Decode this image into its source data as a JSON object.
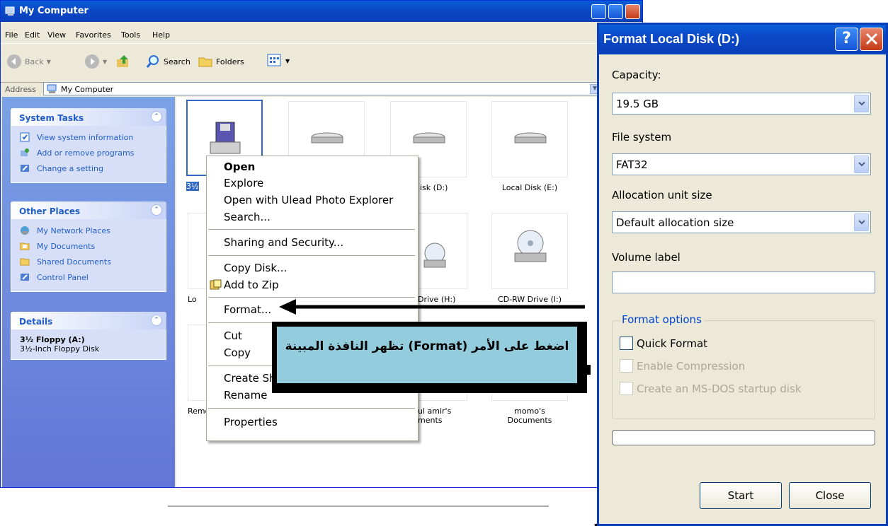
{
  "explorer": {
    "title": "My Computer",
    "menu": [
      "File",
      "Edit",
      "View",
      "Favorites",
      "Tools",
      "Help"
    ],
    "toolbar": {
      "back": "Back",
      "search": "Search",
      "folders": "Folders"
    },
    "address_label": "Address",
    "address_value": "My Computer",
    "system_tasks": {
      "title": "System Tasks",
      "items": [
        "View system information",
        "Add or remove programs",
        "Change a setting"
      ]
    },
    "other_places": {
      "title": "Other Places",
      "items": [
        "My Network Places",
        "My Documents",
        "Shared Documents",
        "Control Panel"
      ]
    },
    "details": {
      "title": "Details",
      "name": "3½ Floppy (A:)",
      "type": "3½-Inch Floppy Disk"
    },
    "drives": {
      "floppy_partial": "3½",
      "local_d_partial": "isk (D:)",
      "local_e": "Local Disk (E:)",
      "row2_left_partial": "Lo",
      "drive_h_partial": "Drive (H:)",
      "cdrw_i": "CD-RW Drive (I:)",
      "removable_partial": "Remo",
      "docs_partial_1": "ul amir's",
      "docs_partial_2": "ments",
      "momo_docs": "momo's Documents"
    }
  },
  "context_menu": {
    "open": "Open",
    "explore": "Explore",
    "open_with": "Open with Ulead Photo Explorer",
    "search": "Search...",
    "sharing": "Sharing and Security...",
    "copy_disk": "Copy Disk...",
    "add_zip": "Add to Zip",
    "format": "Format...",
    "cut": "Cut",
    "copy": "Copy",
    "create_shortcut_partial": "Create Sh",
    "rename": "Rename",
    "properties": "Properties"
  },
  "format_dialog": {
    "title": "Format Local Disk (D:)",
    "help": "?",
    "capacity_label": "Capacity:",
    "capacity_value": "19.5 GB",
    "fs_label": "File system",
    "fs_value": "FAT32",
    "alloc_label": "Allocation unit size",
    "alloc_value": "Default allocation size",
    "volume_label": "Volume label",
    "volume_value": "",
    "options_legend": "Format options",
    "quick_format": "Quick Format",
    "enable_compression": "Enable Compression",
    "msdos_disk": "Create an MS-DOS startup disk",
    "start": "Start",
    "close": "Close"
  },
  "annotation": {
    "callout_text": "اضغط على الأمر (Format) تظهر النافذة المبينة"
  },
  "colors": {
    "titlebar": "#0a4fd0",
    "callout_bg": "#93cddd",
    "task_link": "#215dc6"
  }
}
